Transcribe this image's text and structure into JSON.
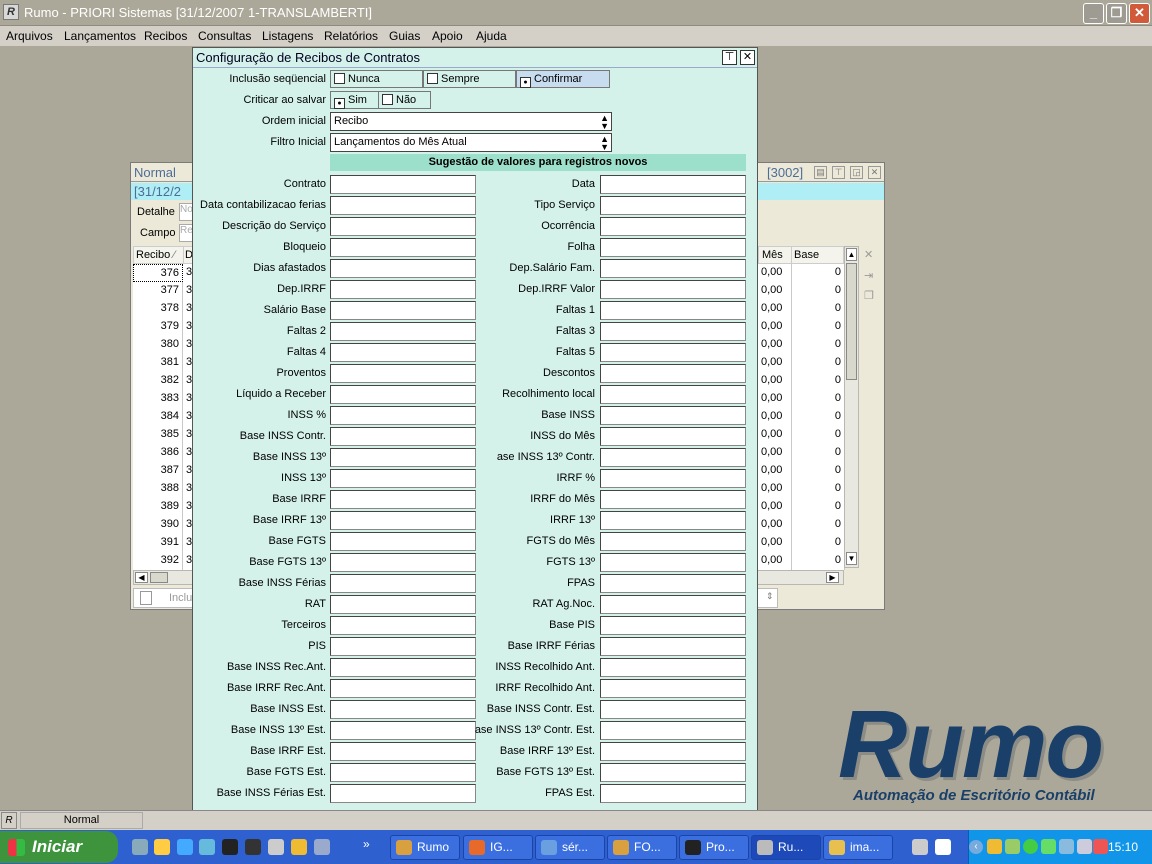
{
  "window": {
    "title": "Rumo - PRIORI Sistemas [31/12/2007 1-TRANSLAMBERTI]"
  },
  "menu": [
    "Arquivos",
    "Lançamentos",
    "Recibos",
    "Consultas",
    "Listagens",
    "Relatórios",
    "Guias",
    "Apoio",
    "Ajuda"
  ],
  "bg_window": {
    "mode": "Normal",
    "code": "[3002]",
    "date": "[31/12/2",
    "detalhe_label": "Detalhe",
    "detalhe_placeholder": "No",
    "campo_label": "Campo",
    "campo_placeholder": "Re",
    "col_recibo": "Recibo",
    "col_d": "D",
    "col_mes": "Mês",
    "col_base_irrf": "Base IRRF",
    "include_label": "Inclu",
    "rows": [
      {
        "recibo": "376",
        "d": "3",
        "mes": "0,00",
        "base": "0"
      },
      {
        "recibo": "377",
        "d": "3",
        "mes": "0,00",
        "base": "0"
      },
      {
        "recibo": "378",
        "d": "3",
        "mes": "0,00",
        "base": "0"
      },
      {
        "recibo": "379",
        "d": "3",
        "mes": "0,00",
        "base": "0"
      },
      {
        "recibo": "380",
        "d": "3",
        "mes": "0,00",
        "base": "0"
      },
      {
        "recibo": "381",
        "d": "3",
        "mes": "0,00",
        "base": "0"
      },
      {
        "recibo": "382",
        "d": "3",
        "mes": "0,00",
        "base": "0"
      },
      {
        "recibo": "383",
        "d": "3",
        "mes": "0,00",
        "base": "0"
      },
      {
        "recibo": "384",
        "d": "3",
        "mes": "0,00",
        "base": "0"
      },
      {
        "recibo": "385",
        "d": "3",
        "mes": "0,00",
        "base": "0"
      },
      {
        "recibo": "386",
        "d": "3",
        "mes": "0,00",
        "base": "0"
      },
      {
        "recibo": "387",
        "d": "3",
        "mes": "0,00",
        "base": "0"
      },
      {
        "recibo": "388",
        "d": "3",
        "mes": "0,00",
        "base": "0"
      },
      {
        "recibo": "389",
        "d": "3",
        "mes": "0,00",
        "base": "0"
      },
      {
        "recibo": "390",
        "d": "3",
        "mes": "0,00",
        "base": "0"
      },
      {
        "recibo": "391",
        "d": "3",
        "mes": "0,00",
        "base": "0"
      },
      {
        "recibo": "392",
        "d": "3",
        "mes": "0,00",
        "base": "0"
      }
    ]
  },
  "dialog": {
    "title": "Configuração de Recibos de Contratos",
    "inclusao_label": "Inclusão seqüencial",
    "inclusao_options": [
      {
        "label": "Nunca",
        "selected": false
      },
      {
        "label": "Sempre",
        "selected": false
      },
      {
        "label": "Confirmar",
        "selected": true
      }
    ],
    "criticar_label": "Criticar ao salvar",
    "criticar_options": [
      {
        "label": "Sim",
        "selected": true
      },
      {
        "label": "Não",
        "selected": false
      }
    ],
    "ordem_label": "Ordem inicial",
    "ordem_value": "Recibo",
    "filtro_label": "Filtro Inicial",
    "filtro_value": "Lançamentos do Mês Atual",
    "section_title": "Sugestão de valores para registros novos",
    "left_fields": [
      "Contrato",
      "Data contabilizacao ferias",
      "Descrição do Serviço",
      "Bloqueio",
      "Dias afastados",
      "Dep.IRRF",
      "Salário Base",
      "Faltas 2",
      "Faltas 4",
      "Proventos",
      "Líquido a Receber",
      "INSS %",
      "Base INSS Contr.",
      "Base INSS 13º",
      "INSS 13º",
      "Base IRRF",
      "Base IRRF 13º",
      "Base FGTS",
      "Base FGTS 13º",
      "Base INSS Férias",
      "RAT",
      "Terceiros",
      "PIS",
      "Base INSS Rec.Ant.",
      "Base IRRF Rec.Ant.",
      "Base INSS Est.",
      "Base INSS 13º Est.",
      "Base IRRF Est.",
      "Base FGTS Est.",
      "Base INSS Férias Est."
    ],
    "right_fields": [
      "Data",
      "Tipo Serviço",
      "Ocorrência",
      "Folha",
      "Dep.Salário Fam.",
      "Dep.IRRF Valor",
      "Faltas 1",
      "Faltas 3",
      "Faltas 5",
      "Descontos",
      "Recolhimento local",
      "Base INSS",
      "INSS do Mês",
      "ase INSS 13º Contr.",
      "IRRF %",
      "IRRF do Mês",
      "IRRF 13º",
      "FGTS do Mês",
      "FGTS 13º",
      "FPAS",
      "RAT Ag.Noc.",
      "Base PIS",
      "Base IRRF Férias",
      "INSS Recolhido Ant.",
      "IRRF Recolhido Ant.",
      "Base INSS Contr. Est.",
      "ase INSS 13º Contr. Est.",
      "Base IRRF 13º Est.",
      "Base FGTS 13º Est.",
      "FPAS Est."
    ]
  },
  "logo": {
    "name": "Rumo",
    "tagline": "Automação de Escritório Contábil"
  },
  "status": {
    "mode": "Normal"
  },
  "taskbar": {
    "start": "Iniciar",
    "tasks": [
      "Rumo",
      "IG...",
      "sér...",
      "FO...",
      "Pro...",
      "Ru...",
      "ima..."
    ],
    "clock": "15:10"
  }
}
